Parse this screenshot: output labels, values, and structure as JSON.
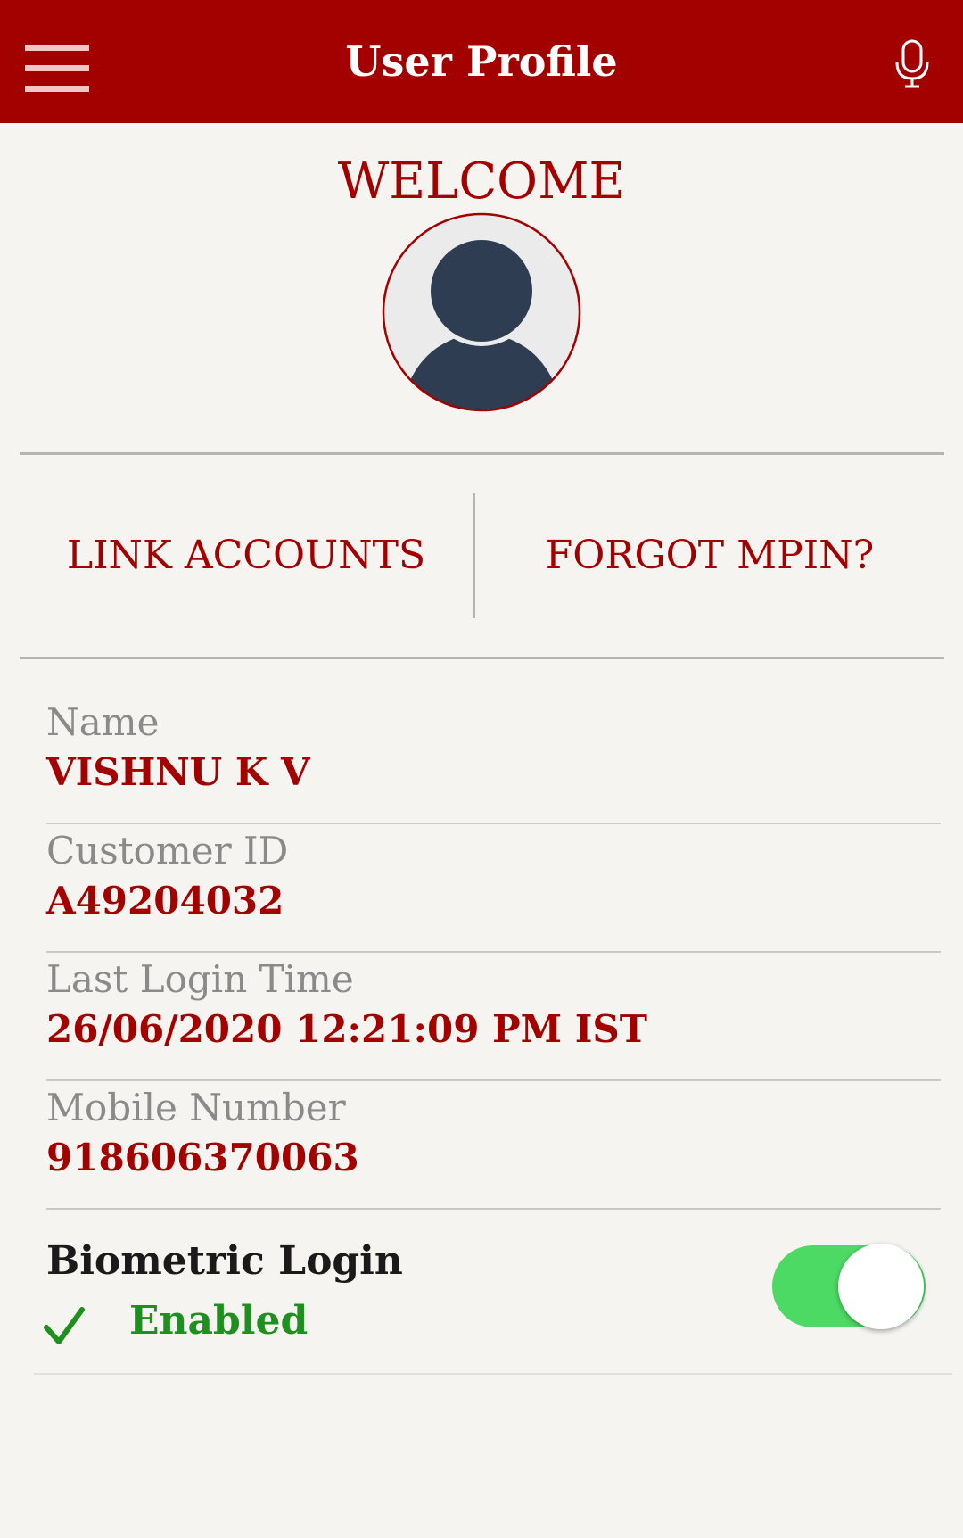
{
  "header": {
    "title": "User Profile",
    "menu_icon": "hamburger-menu-icon",
    "mic_icon": "microphone-icon"
  },
  "welcome": {
    "text": "WELCOME",
    "avatar_icon": "user-avatar-icon"
  },
  "actions": {
    "link_accounts": "LINK ACCOUNTS",
    "forgot_mpin": "FORGOT MPIN?"
  },
  "fields": [
    {
      "label": "Name",
      "value": "VISHNU K V"
    },
    {
      "label": "Customer ID",
      "value": "A49204032"
    },
    {
      "label": "Last Login Time",
      "value": "26/06/2020 12:21:09 PM IST"
    },
    {
      "label": "Mobile Number",
      "value": "918606370063"
    }
  ],
  "biometric": {
    "title": "Biometric Login",
    "status": "Enabled",
    "status_icon": "checkmark-icon",
    "toggle_on": true
  },
  "colors": {
    "brand": "#a30000",
    "background": "#f5f4f1",
    "label_gray": "#8a8a8a",
    "enabled_green": "#1f8f1f",
    "toggle_green": "#4cd964"
  }
}
